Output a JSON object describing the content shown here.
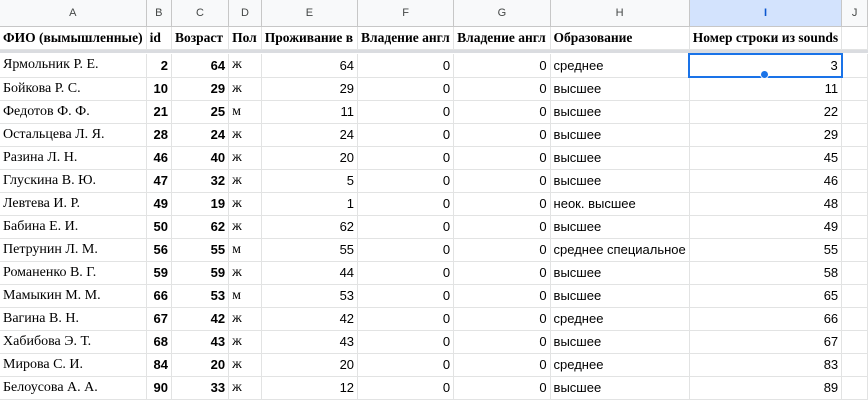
{
  "columns": [
    "A",
    "B",
    "C",
    "D",
    "E",
    "F",
    "G",
    "H",
    "I",
    "J"
  ],
  "selected_column": "I",
  "headers": [
    "ФИО (вымышленные)",
    "id",
    "Возраст",
    "Пол",
    "Проживание в",
    "Владение англ",
    "Владение англ",
    "Образование",
    "Номер строки из sounds",
    ""
  ],
  "rows": [
    [
      "Ярмольник Р. Е.",
      "2",
      "64",
      "ж",
      "64",
      "0",
      "0",
      "среднее",
      "3"
    ],
    [
      "Бойкова Р. С.",
      "10",
      "29",
      "ж",
      "29",
      "0",
      "0",
      "высшее",
      "11"
    ],
    [
      "Федотов Ф. Ф.",
      "21",
      "25",
      "м",
      "11",
      "0",
      "0",
      "высшее",
      "22"
    ],
    [
      "Остальцева Л. Я.",
      "28",
      "24",
      "ж",
      "24",
      "0",
      "0",
      "высшее",
      "29"
    ],
    [
      "Разина Л. Н.",
      "46",
      "40",
      "ж",
      "20",
      "0",
      "0",
      "высшее",
      "45"
    ],
    [
      "Глускина В. Ю.",
      "47",
      "32",
      "ж",
      "5",
      "0",
      "0",
      "высшее",
      "46"
    ],
    [
      "Левтева И. Р.",
      "49",
      "19",
      "ж",
      "1",
      "0",
      "0",
      "неок. высшее",
      "48"
    ],
    [
      "Бабина Е. И.",
      "50",
      "62",
      "ж",
      "62",
      "0",
      "0",
      "высшее",
      "49"
    ],
    [
      "Петрунин Л. М.",
      "56",
      "55",
      "м",
      "55",
      "0",
      "0",
      "среднее специальное",
      "55"
    ],
    [
      "Романенко В. Г.",
      "59",
      "59",
      "ж",
      "44",
      "0",
      "0",
      "высшее",
      "58"
    ],
    [
      "Мамыкин М. М.",
      "66",
      "53",
      "м",
      "53",
      "0",
      "0",
      "высшее",
      "65"
    ],
    [
      "Вагина В. Н.",
      "67",
      "42",
      "ж",
      "42",
      "0",
      "0",
      "среднее",
      "66"
    ],
    [
      "Хабибова Э. Т.",
      "68",
      "43",
      "ж",
      "43",
      "0",
      "0",
      "высшее",
      "67"
    ],
    [
      "Мирова С. И.",
      "84",
      "20",
      "ж",
      "20",
      "0",
      "0",
      "среднее",
      "83"
    ],
    [
      "Белоусова А. А.",
      "90",
      "33",
      "ж",
      "12",
      "0",
      "0",
      "высшее",
      "89"
    ]
  ],
  "active_cell": {
    "row": 0,
    "column": "I",
    "value": "3"
  },
  "colors": {
    "selection": "#1a73e8",
    "header_bg": "#f8f9fa",
    "selected_header_bg": "#d3e3fd"
  }
}
